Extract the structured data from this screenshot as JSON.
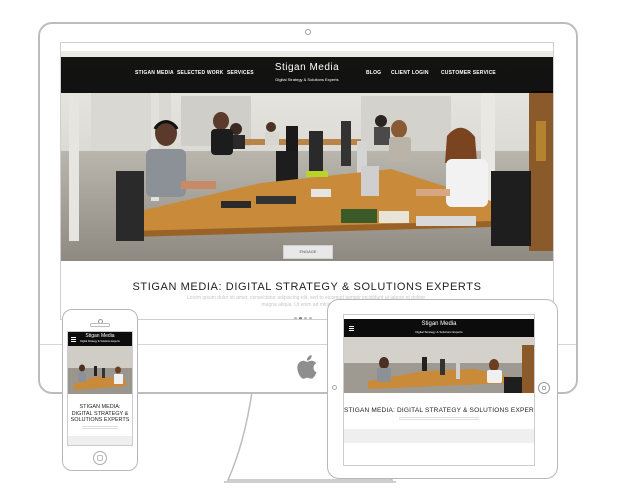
{
  "desktop": {
    "nav": {
      "left_items": [
        "STIGAN MEDIA",
        "SELECTED WORK",
        "SERVICES"
      ],
      "right_items": [
        "BLOG",
        "CLIENT LOGIN",
        "CUSTOMER SERVICE"
      ]
    },
    "logo": {
      "name": "Stigan Media",
      "tagline": "Digital Strategy & Solutions Experts"
    },
    "engage_label": "ENGAGE",
    "headline": "STIGAN MEDIA: DIGITAL STRATEGY & SOLUTIONS EXPERTS",
    "body_text": "Lorem ipsum dolor sit amet, consectetur adipiscing elit, sed to eiusmod tempor incididunt ut labore et dolore magna aliqua. Ut enim ad minim veniam",
    "carousel": {
      "count": 4,
      "active": 1
    }
  },
  "phone": {
    "logo": "Stigan Media",
    "tagline": "Digital Strategy & Solutions Experts",
    "headline": "STIGAN MEDIA: DIGITAL STRATEGY & SOLUTIONS EXPERTS"
  },
  "tablet": {
    "logo": "Stigan Media",
    "tagline": "Digital Strategy & Solutions Experts",
    "headline": "STIGAN MEDIA: DIGITAL STRATEGY & SOLUTIONS EXPERTS"
  },
  "colors": {
    "nav_bg": "#0a0a0a",
    "frame": "#bdbdbd",
    "desk": "#c98a3a",
    "text": "#222222"
  }
}
